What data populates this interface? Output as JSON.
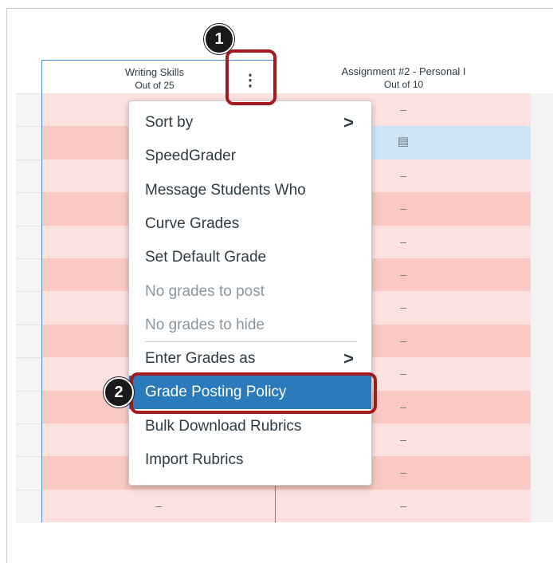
{
  "columns": [
    {
      "title": "Writing Skills",
      "subtitle": "Out of 25"
    },
    {
      "title": "Assignment #2 - Personal I",
      "subtitle": "Out of 10"
    }
  ],
  "dash": "–",
  "menu": {
    "items": [
      {
        "label": "Sort by",
        "submenu": true,
        "disabled": false
      },
      {
        "label": "SpeedGrader",
        "submenu": false,
        "disabled": false
      },
      {
        "label": "Message Students Who",
        "submenu": false,
        "disabled": false
      },
      {
        "label": "Curve Grades",
        "submenu": false,
        "disabled": false
      },
      {
        "label": "Set Default Grade",
        "submenu": false,
        "disabled": false
      },
      {
        "label": "No grades to post",
        "submenu": false,
        "disabled": true
      },
      {
        "label": "No grades to hide",
        "submenu": false,
        "disabled": true
      },
      {
        "label": "Enter Grades as",
        "submenu": true,
        "disabled": false
      },
      {
        "label": "Grade Posting Policy",
        "submenu": false,
        "disabled": false,
        "highlighted": true
      },
      {
        "label": "Bulk Download Rubrics",
        "submenu": false,
        "disabled": false
      },
      {
        "label": "Import Rubrics",
        "submenu": false,
        "disabled": false
      }
    ],
    "chevron": ">"
  },
  "callouts": {
    "one": "1",
    "two": "2"
  },
  "kebab_glyph": "⋮",
  "colors": {
    "accent": "#2b7abc",
    "callout_border": "#a31b1f",
    "cell_pink": "#fde1df",
    "cell_pink_dark": "#fbc9c4",
    "cell_blue": "#cfe5f7"
  }
}
